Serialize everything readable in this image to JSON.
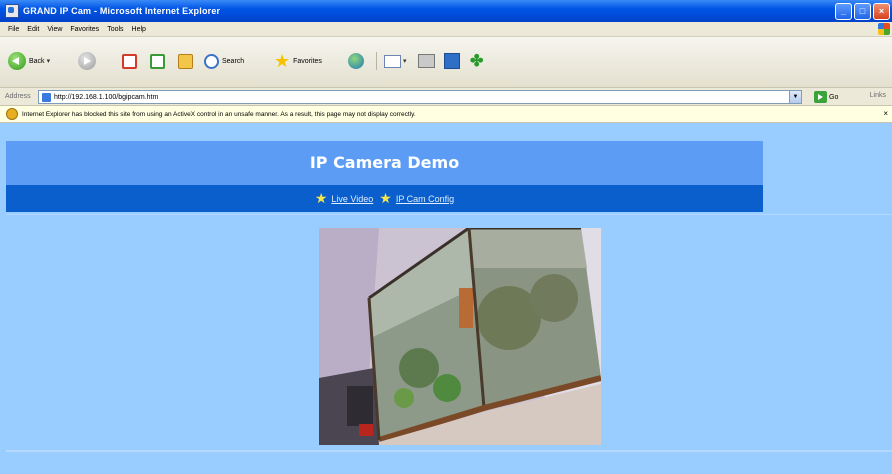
{
  "window": {
    "title": "GRAND IP Cam - Microsoft Internet Explorer",
    "controls": [
      "_",
      "□",
      "×"
    ]
  },
  "menu": [
    "File",
    "Edit",
    "View",
    "Favorites",
    "Tools",
    "Help"
  ],
  "toolbar": {
    "back_label": "Back",
    "search_label": "Search",
    "favorites_label": "Favorites"
  },
  "address": {
    "label": "Address",
    "url": "http://192.168.1.100/bgipcam.htm",
    "go_label": "Go",
    "links_label": "Links"
  },
  "infobar": {
    "message": "Internet Explorer has blocked this site from using an ActiveX control in an unsafe manner. As a result, this page may not display correctly."
  },
  "page": {
    "title": "IP Camera Demo",
    "nav": [
      {
        "label": "Live Video"
      },
      {
        "label": "IP Cam Config"
      }
    ]
  }
}
